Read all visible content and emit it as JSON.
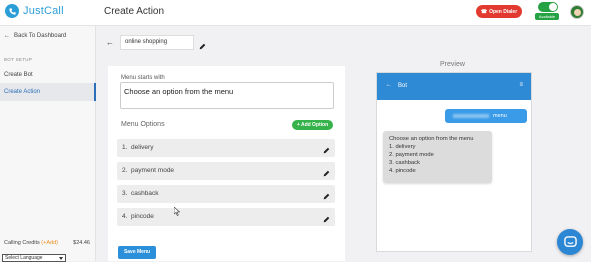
{
  "brand": {
    "name": "JustCall",
    "color": "#2b9ed8"
  },
  "header": {
    "title": "Create Action",
    "dialer_button": "Open Dialer",
    "availability_badge": "Available"
  },
  "sidebar": {
    "back_link": "Back To Dashboard",
    "section_label": "BOT SETUP",
    "items": [
      {
        "label": "Create Bot",
        "active": false
      },
      {
        "label": "Create Action",
        "active": true
      }
    ],
    "credits_label": "Calling Credits",
    "credits_add": "(+Add)",
    "credits_amount": "$24.46",
    "language_select": "Select Language"
  },
  "action_name": {
    "value": "online shopping"
  },
  "editor": {
    "menu_starts_label": "Menu starts with",
    "menu_starts_value": "Choose an option from the menu",
    "options_title": "Menu Options",
    "add_option_label": "+ Add Option",
    "options": [
      {
        "index": "1.",
        "label": "delivery"
      },
      {
        "index": "2.",
        "label": "payment mode"
      },
      {
        "index": "3.",
        "label": "cashback"
      },
      {
        "index": "4.",
        "label": "pincode"
      }
    ],
    "save_label": "Save Menu"
  },
  "preview": {
    "title": "Preview",
    "bot_name": "Bot",
    "user_message_visible": "menu",
    "bot_lines": [
      "Choose an option from the menu",
      "1. delivery",
      "2. payment mode",
      "3. cashback",
      "4. pincode"
    ]
  },
  "colors": {
    "primary": "#2b8fd9",
    "success": "#36b24a",
    "danger": "#e23a2f",
    "credits_add": "#f08c1a"
  }
}
